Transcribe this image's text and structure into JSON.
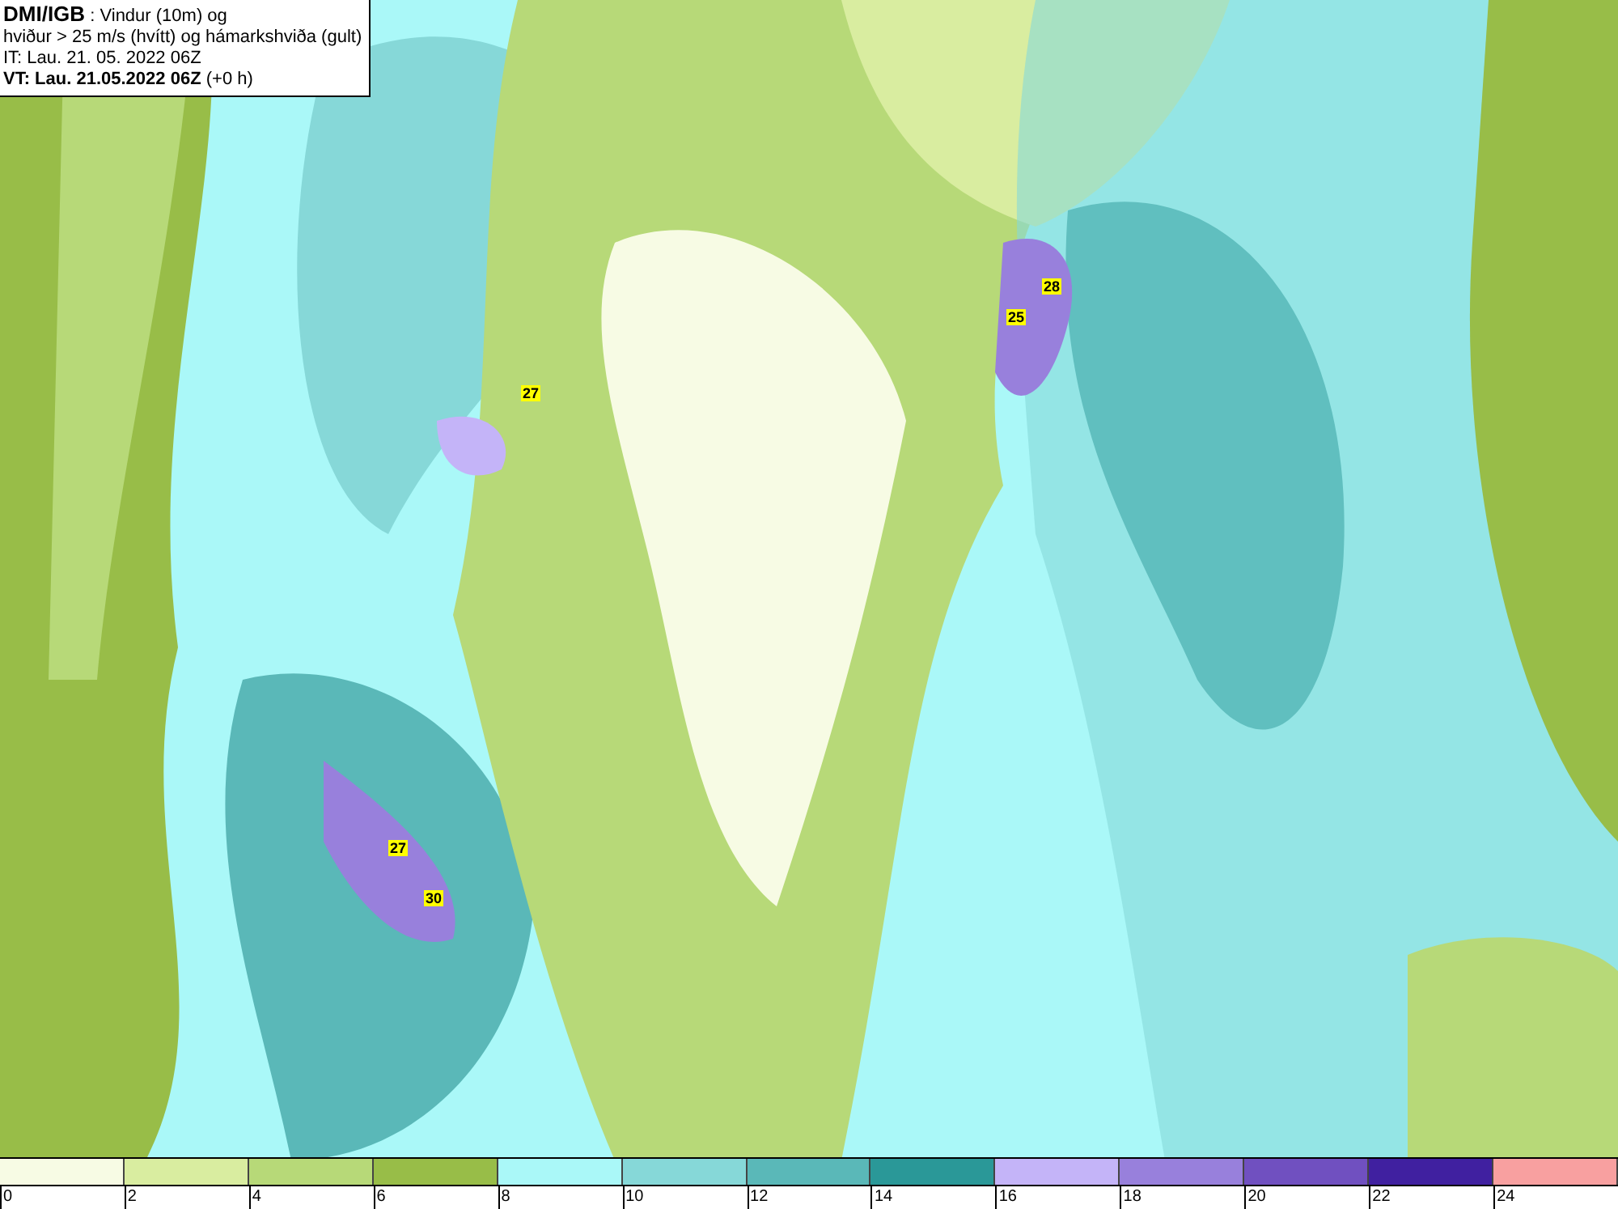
{
  "info_box": {
    "source": "DMI/IGB",
    "title_rest": " : Vindur (10m) og",
    "subtitle": "hviður > 25 m/s (hvítt) og hámarkshviða (gult)",
    "initial_time": "IT: Lau. 21. 05. 2022 06Z",
    "valid_time": "**VT: Lau. 21.05.2022 06Z** (+0 h)"
  },
  "gust_labels": [
    "27",
    "28",
    "25",
    "27",
    "30"
  ],
  "legend": [
    {
      "label": "0",
      "color": "#f7fbe4"
    },
    {
      "label": "2",
      "color": "#d9eda0"
    },
    {
      "label": "4",
      "color": "#b7d978"
    },
    {
      "label": "6",
      "color": "#98bd48"
    },
    {
      "label": "8",
      "color": "#aaf8f8"
    },
    {
      "label": "10",
      "color": "#86d8d8"
    },
    {
      "label": "12",
      "color": "#5ab8b8"
    },
    {
      "label": "14",
      "color": "#2a9898"
    },
    {
      "label": "16",
      "color": "#c4b4f8"
    },
    {
      "label": "18",
      "color": "#9880dc"
    },
    {
      "label": "20",
      "color": "#7050c0"
    },
    {
      "label": "22",
      "color": "#4020a0"
    },
    {
      "label": "24",
      "color": "#f8a0a0"
    }
  ]
}
